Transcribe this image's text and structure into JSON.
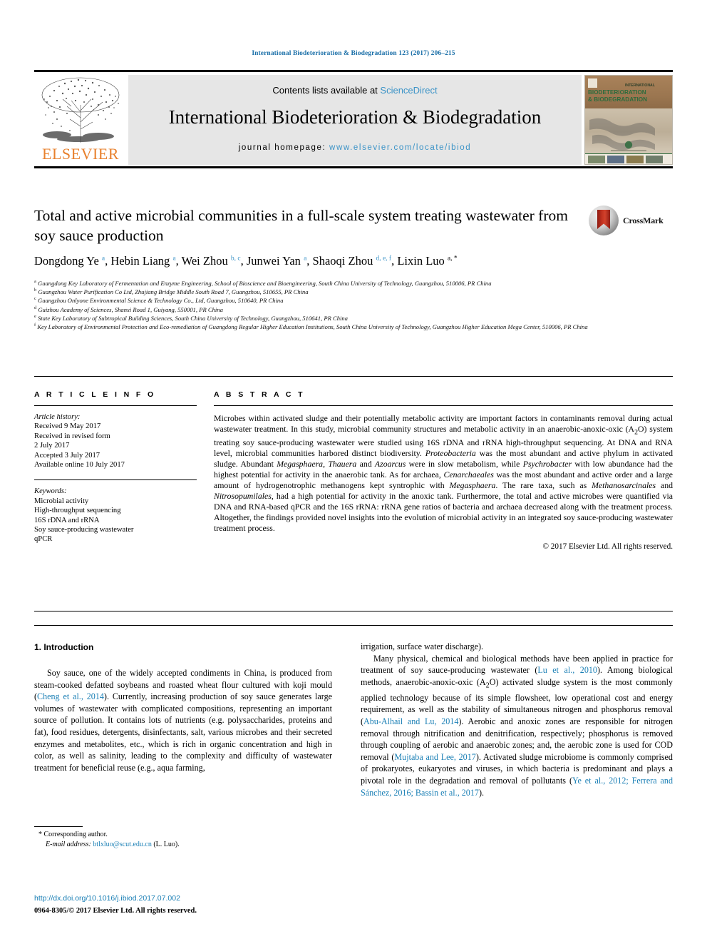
{
  "running_head": "International Biodeterioration & Biodegradation 123 (2017) 206–215",
  "masthead": {
    "contents_prefix": "Contents lists available at ",
    "sciencedirect": "ScienceDirect",
    "journal_title": "International Biodeterioration & Biodegradation",
    "homepage_prefix": "journal homepage: ",
    "homepage_url": "www.elsevier.com/locate/ibiod",
    "publisher": "ELSEVIER",
    "publisher_color": "#E8812E",
    "link_color": "#3b93c7",
    "cover_title_line1": "INTERNATIONAL",
    "cover_title_line2": "BIODETERIORATION",
    "cover_title_line3": "& BIODEGRADATION"
  },
  "article": {
    "title": "Total and active microbial communities in a full-scale system treating wastewater from soy sauce production",
    "crossmark_label": "CrossMark",
    "authors_html": "Dongdong Ye <sup>a</sup>, Hebin Liang <sup>a</sup>, Wei Zhou <sup>b, c</sup>, Junwei Yan <sup>a</sup>, Shaoqi Zhou <sup>d, e, f</sup>, Lixin Luo <sup class=\"star\">a, *</sup>",
    "affiliations": [
      {
        "marker": "a",
        "text": "Guangdong Key Laboratory of Fermentation and Enzyme Engineering, School of Bioscience and Bioengineering, South China University of Technology, Guangzhou, 510006, PR China"
      },
      {
        "marker": "b",
        "text": "Guangzhou Water Purification Co Ltd, Zhujiang Bridge Middle South Road 7, Guangzhou, 510655, PR China"
      },
      {
        "marker": "c",
        "text": "Guangzhou Onlyone Environmental Science & Technology Co., Ltd, Guangzhou, 510640, PR China"
      },
      {
        "marker": "d",
        "text": "Guizhou Academy of Sciences, Shanxi Road 1, Guiyang, 550001, PR China"
      },
      {
        "marker": "e",
        "text": "State Key Laboratory of Subtropical Building Sciences, South China University of Technology, Guangzhou, 510641, PR China"
      },
      {
        "marker": "f",
        "text": "Key Laboratory of Environmental Protection and Eco-remediation of Guangdong Regular Higher Education Institutions, South China University of Technology, Guangzhou Higher Education Mega Center, 510006, PR China"
      }
    ]
  },
  "article_info": {
    "heading": "A R T I C L E   I N F O",
    "history_label": "Article history:",
    "history": [
      "Received 9 May 2017",
      "Received in revised form",
      "2 July 2017",
      "Accepted 3 July 2017",
      "Available online 10 July 2017"
    ],
    "keywords_label": "Keywords:",
    "keywords": [
      "Microbial activity",
      "High-throughput sequencing",
      "16S rDNA and rRNA",
      "Soy sauce-producing wastewater",
      "qPCR"
    ]
  },
  "abstract": {
    "heading": "A B S T R A C T",
    "paragraph_html": "Microbes within activated sludge and their potentially metabolic activity are important factors in contaminants removal during actual wastewater treatment. In this study, microbial community structures and metabolic activity in an anaerobic-anoxic-oxic (A<sub>2</sub>O) system treating soy sauce-producing wastewater were studied using 16S rDNA and rRNA high-throughput sequencing. At DNA and RNA level, microbial communities harbored distinct biodiversity. <i>Proteobacteria</i> was the most abundant and active phylum in activated sludge. Abundant <i>Megasphaera</i>, <i>Thauera</i> and <i>Azoarcus</i> were in slow metabolism, while <i>Psychrobacter</i> with low abundance had the highest potential for activity in the anaerobic tank. As for archaea, <i>Cenarchaeales</i> was the most abundant and active order and a large amount of hydrogenotrophic methanogens kept syntrophic with <i>Megasphaera</i>. The rare taxa, such as <i>Methanosarcinales</i> and <i>Nitrosopumilales</i>, had a high potential for activity in the anoxic tank. Furthermore, the total and active microbes were quantified via DNA and RNA-based qPCR and the 16S rRNA: rRNA gene ratios of bacteria and archaea decreased along with the treatment process. Altogether, the findings provided novel insights into the evolution of microbial activity in an integrated soy sauce-producing wastewater treatment process.",
    "copyright": "© 2017 Elsevier Ltd. All rights reserved."
  },
  "body": {
    "intro_heading": "1. Introduction",
    "left_column_html": "<p class=\"indent\">Soy sauce, one of the widely accepted condiments in China, is produced from steam-cooked defatted soybeans and roasted wheat flour cultured with koji mould (<span class=\"cite\">Cheng et al., 2014</span>). Currently, increasing production of soy sauce generates large volumes of wastewater with complicated compositions, representing an important source of pollution. It contains lots of nutrients (e.g. polysaccharides, proteins and fat), food residues, detergents, disinfectants, salt, various microbes and their secreted enzymes and metabolites, etc., which is rich in organic concentration and high in color, as well as salinity, leading to the complexity and difficulty of wastewater treatment for beneficial reuse (e.g., aqua farming,</p>",
    "right_column_html": "<p>irrigation, surface water discharge).</p><p class=\"indent\">Many physical, chemical and biological methods have been applied in practice for treatment of soy sauce-producing wastewater (<span class=\"cite\">Lu et al., 2010</span>). Among biological methods, anaerobic-anoxic-oxic (A<sub>2</sub>O) activated sludge system is the most commonly applied technology because of its simple flowsheet, low operational cost and energy requirement, as well as the stability of simultaneous nitrogen and phosphorus removal (<span class=\"cite\">Abu-Alhail and Lu, 2014</span>). Aerobic and anoxic zones are responsible for nitrogen removal through nitrification and denitrification, respectively; phosphorus is removed through coupling of aerobic and anaerobic zones; and, the aerobic zone is used for COD removal (<span class=\"cite\">Mujtaba and Lee, 2017</span>). Activated sludge microbiome is commonly comprised of prokaryotes, eukaryotes and viruses, in which bacteria is predominant and plays a pivotal role in the degradation and removal of pollutants (<span class=\"cite\">Ye et al., 2012; Ferrera and Sánchez, 2016; Bassin et al., 2017</span>).</p>"
  },
  "footnote": {
    "corresponding_marker": "*",
    "corresponding_text": "Corresponding author.",
    "email_label": "E-mail address:",
    "email": "btlxluo@scut.edu.cn",
    "email_owner": "(L. Luo)."
  },
  "footer": {
    "doi": "http://dx.doi.org/10.1016/j.ibiod.2017.07.002",
    "issn_line": "0964-8305/© 2017 Elsevier Ltd. All rights reserved."
  }
}
